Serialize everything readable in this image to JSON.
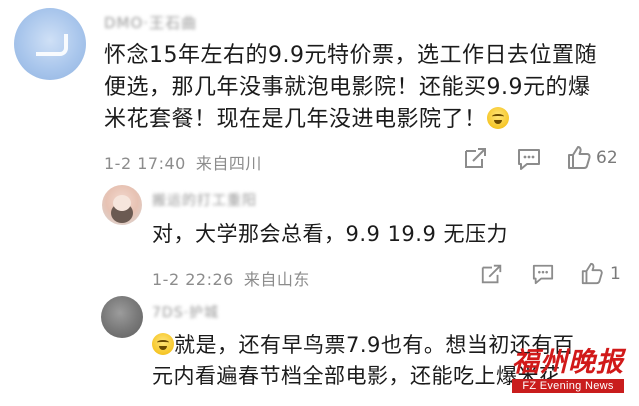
{
  "comment": {
    "username": "DMO·王石曲",
    "text_lines": [
      "怀念15年左右的9.9元特价票，选工作日去位置随",
      "便选，那几年没事就泡电影院！还能买9.9元的爆",
      "米花套餐！现在是几年没进电影院了！"
    ],
    "timestamp": "1-2 17:40",
    "location": "来自四川",
    "like_count": "62"
  },
  "replies": [
    {
      "username": "搬运的打工重阳",
      "text": "对，大学那会总看，9.9 19.9 无压力",
      "timestamp": "1-2 22:26",
      "location": "来自山东",
      "like_count": "1"
    },
    {
      "username": "7DS·护城",
      "text_lines": [
        "就是，还有早鸟票7.9也有。想当初还有百",
        "元内看遍春节档全部电影，还能吃上爆米花"
      ]
    }
  ],
  "watermark": {
    "main": "福州晚报",
    "sub": "FZ Evening News"
  },
  "icons": [
    "share-icon",
    "comment-icon",
    "like-icon",
    "laugh-emoji-icon"
  ],
  "colors": {
    "text": "#1b1b1b",
    "meta": "#8c8c8c",
    "watermark": "#d11919"
  }
}
